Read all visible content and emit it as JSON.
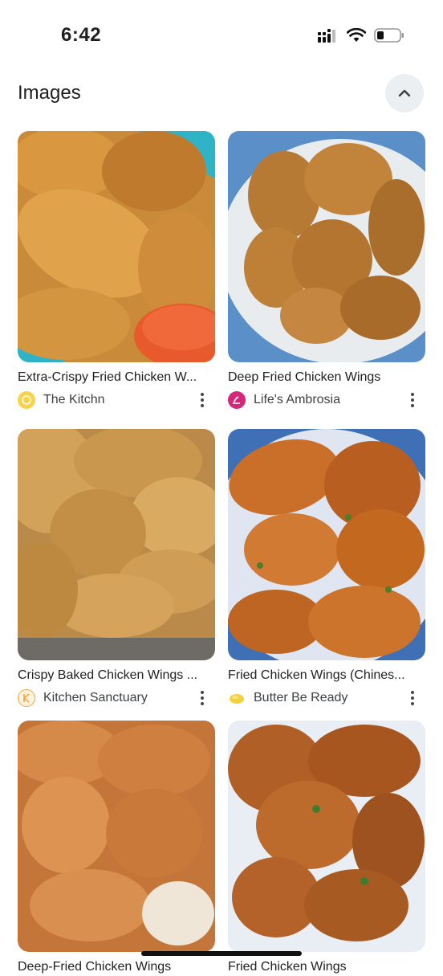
{
  "status": {
    "time": "6:42"
  },
  "section": {
    "title": "Images"
  },
  "results": [
    {
      "caption": "Extra-Crispy Fried Chicken W...",
      "source": "The Kitchn",
      "favicon_color": "#f2c230"
    },
    {
      "caption": "Deep Fried Chicken Wings",
      "source": "Life's Ambrosia",
      "favicon_color": "#d6287a"
    },
    {
      "caption": "Crispy Baked Chicken Wings ...",
      "source": "Kitchen Sanctuary",
      "favicon_color": "#f3a43b"
    },
    {
      "caption": "Fried Chicken Wings (Chines...",
      "source": "Butter Be Ready",
      "favicon_color": "#f4d03f"
    },
    {
      "caption": "Deep-Fried Chicken Wings",
      "source": "",
      "favicon_color": ""
    },
    {
      "caption": "Fried Chicken Wings",
      "source": "",
      "favicon_color": ""
    }
  ],
  "icons": {
    "signal": "signal-icon",
    "wifi": "wifi-icon",
    "battery": "battery-icon",
    "collapse": "chevron-up-icon",
    "more": "more-vert-icon"
  },
  "colors": {
    "background": "#ffffff",
    "text": "#1f1f1f",
    "secondary": "#3c4043",
    "button_bg": "#eceff1"
  }
}
